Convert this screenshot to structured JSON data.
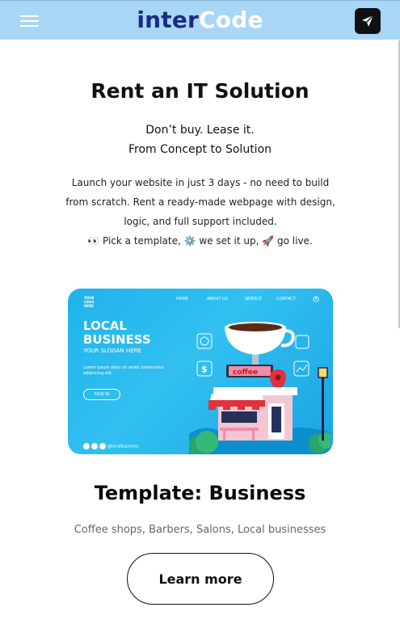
{
  "header": {
    "logo_part1": "inter",
    "logo_part2": "Code",
    "menu_icon": "hamburger-menu-icon",
    "send_icon": "paper-plane-icon"
  },
  "hero": {
    "title": "Rent an IT Solution",
    "subtitle_line1": "Don’t buy. Lease it.",
    "subtitle_line2": "From Concept to Solution",
    "description": "Launch your website in just 3 days - no need to build from scratch. Rent a ready-made webpage with design, logic, and full support included.",
    "steps": "👀 Pick a template, ⚙️ we set it up, 🚀 go live."
  },
  "template_card": {
    "image": {
      "logo_text": "YOUR LOGO HERE",
      "nav": [
        "HOME",
        "ABOUT US",
        "SERVICE",
        "CONTACT"
      ],
      "headline": "LOCAL BUSINESS",
      "slogan": "YOUR SLOGAN HERE",
      "lorem": "Lorem ipsum dolor sit amet consectetur adipiscing elit.",
      "sign_in": "SIGN IN",
      "shop_sign": "coffee",
      "social_handle": "@localbusiness"
    },
    "title": "Template: Business",
    "description": "Coffee shops, Barbers, Salons, Local businesses",
    "button_label": "Learn more"
  },
  "colors": {
    "header_bg": "#a9d6f5",
    "logo_dark": "#1c2a86",
    "banner_blue": "#1fb3ec"
  }
}
